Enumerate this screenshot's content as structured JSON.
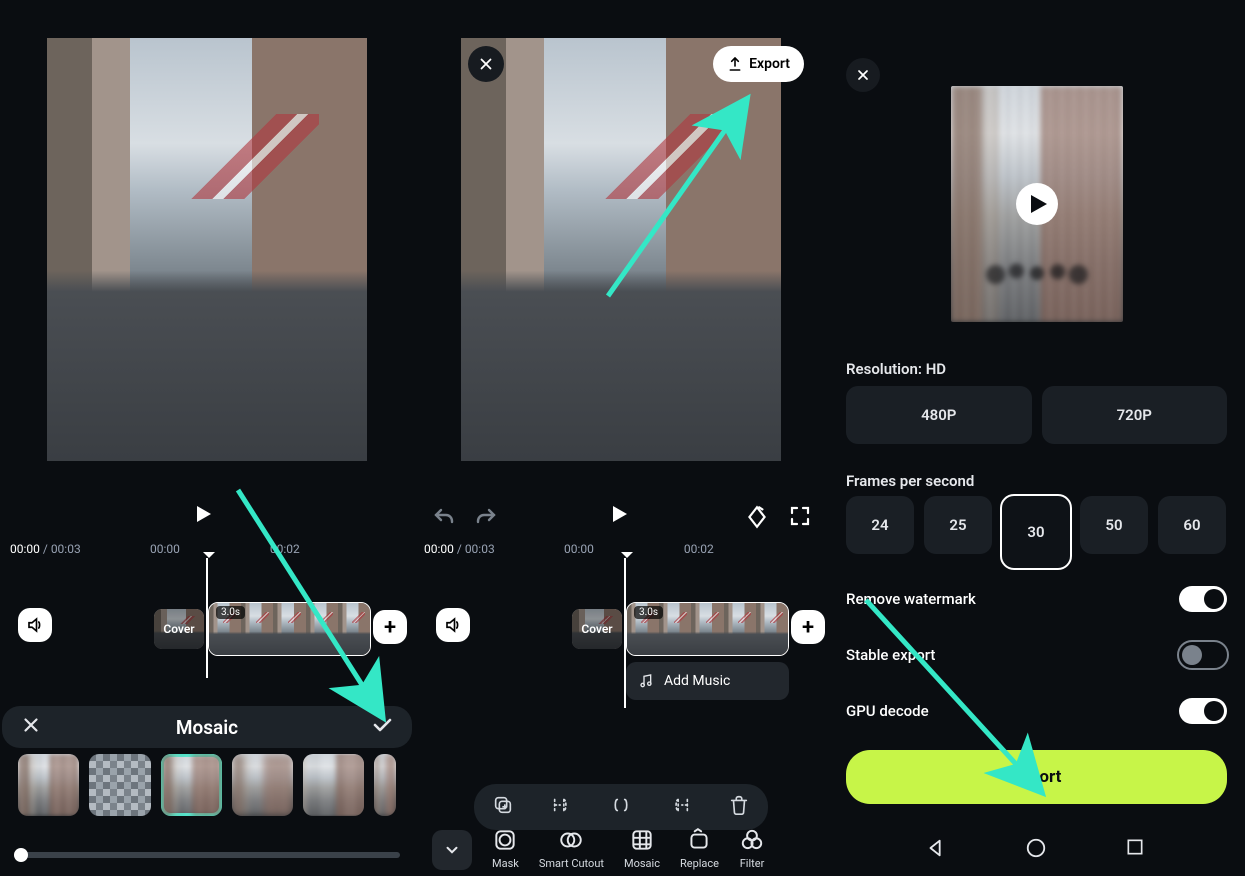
{
  "colors": {
    "accent": "#c7f548",
    "arrow": "#34e7c6",
    "thumb_select": "#34e7c6"
  },
  "timestamps": {
    "current": "00:00",
    "total": "00:03"
  },
  "cover_label": "Cover",
  "clip_duration_tag": "3.0s",
  "ruler_marks": [
    "00:00",
    "00:02"
  ],
  "panel1": {
    "mosaic_title": "Mosaic",
    "selected_thumb_index": 2,
    "thumb_count": 6,
    "slider_value_pct": 0
  },
  "panel2": {
    "export_label": "Export",
    "add_music_label": "Add Music",
    "tools": [
      "Mask",
      "Smart Cutout",
      "Mosaic",
      "Replace",
      "Filter"
    ]
  },
  "panel3": {
    "resolution_label": "Resolution: HD",
    "resolution_options": [
      "480P",
      "720P"
    ],
    "fps_label": "Frames per second",
    "fps_options": [
      "24",
      "25",
      "30",
      "50",
      "60"
    ],
    "fps_selected": "30",
    "toggles": [
      {
        "label": "Remove watermark",
        "on": true
      },
      {
        "label": "Stable export",
        "on": false
      },
      {
        "label": "GPU decode",
        "on": true
      }
    ],
    "export_label": "Export"
  }
}
